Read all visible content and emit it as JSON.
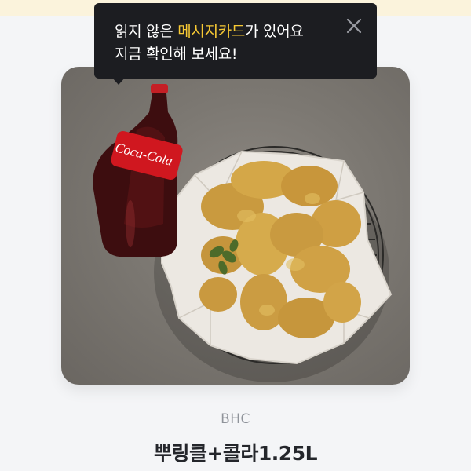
{
  "tooltip": {
    "line1_prefix": "읽지 않은 ",
    "line1_highlight": "메시지카드",
    "line1_suffix": "가 있어요",
    "line2": "지금 확인해 보세요!",
    "close_icon": "close-icon"
  },
  "product": {
    "brand": "BHC",
    "name": "뿌링클+콜라1.25L",
    "image_icon": "fried-chicken-and-cola-image",
    "cola_label": "Coca-Cola"
  },
  "colors": {
    "tooltip_bg": "#1c1d21",
    "highlight": "#f7c934",
    "brand_text": "#8f939a",
    "name_text": "#24262b"
  }
}
